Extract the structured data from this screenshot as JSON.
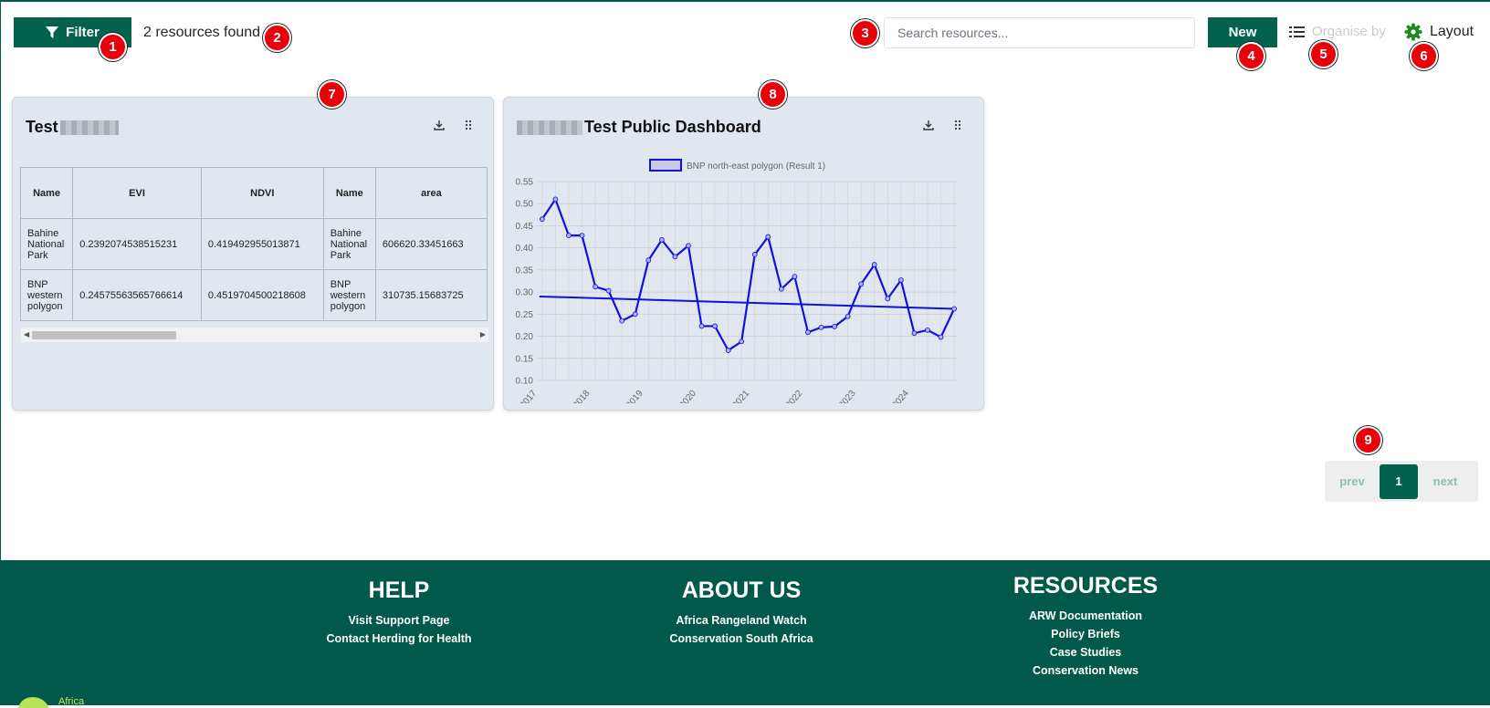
{
  "toolbar": {
    "filter_label": "Filter",
    "count_text": "2 resources found",
    "search_placeholder": "Search resources...",
    "new_label": "New",
    "organise_label": "Organise by",
    "layout_label": "Layout"
  },
  "badges": [
    "1",
    "2",
    "3",
    "4",
    "5",
    "6",
    "7",
    "8",
    "9"
  ],
  "cards": [
    {
      "title": "Test",
      "table": {
        "headers": [
          "Name",
          "EVI",
          "NDVI",
          "Name",
          "area"
        ],
        "rows": [
          [
            "Bahine National Park",
            "0.2392074538515231",
            "0.419492955013871",
            "Bahine National Park",
            "606620.33451663"
          ],
          [
            "BNP western polygon",
            "0.24575563565766614",
            "0.4519704500218608",
            "BNP western polygon",
            "310735.15683725"
          ]
        ]
      }
    },
    {
      "title": "Test Public Dashboard"
    }
  ],
  "chart_data": {
    "type": "line",
    "legend": "BNP north-east polygon (Result 1)",
    "ylim": [
      0.1,
      0.55
    ],
    "yticks": [
      "0.55",
      "0.50",
      "0.45",
      "0.40",
      "0.35",
      "0.30",
      "0.25",
      "0.20",
      "0.15",
      "0.10"
    ],
    "xticks": [
      "2017",
      "2018",
      "2019",
      "2020",
      "2021",
      "2022",
      "2023",
      "2024"
    ],
    "x_years": [
      2017.1,
      2017.35,
      2017.6,
      2017.85,
      2018.1,
      2018.35,
      2018.6,
      2018.85,
      2019.1,
      2019.35,
      2019.6,
      2019.85,
      2020.1,
      2020.35,
      2020.6,
      2020.85,
      2021.1,
      2021.35,
      2021.6,
      2021.85,
      2022.1,
      2022.35,
      2022.6,
      2022.85,
      2023.1,
      2023.35,
      2023.6,
      2023.85,
      2024.1,
      2024.35,
      2024.6,
      2024.85
    ],
    "values": [
      0.465,
      0.51,
      0.428,
      0.428,
      0.312,
      0.303,
      0.235,
      0.25,
      0.372,
      0.418,
      0.38,
      0.405,
      0.223,
      0.223,
      0.168,
      0.188,
      0.385,
      0.425,
      0.307,
      0.335,
      0.209,
      0.22,
      0.222,
      0.245,
      0.318,
      0.362,
      0.285,
      0.327,
      0.207,
      0.214,
      0.198,
      0.262
    ],
    "trend": [
      0.29,
      0.262
    ],
    "color": "#1010e0"
  },
  "pagination": {
    "prev_label": "prev",
    "current": "1",
    "next_label": "next"
  },
  "footer": {
    "help_title": "HELP",
    "help_links": [
      "Visit Support Page",
      "Contact Herding for Health"
    ],
    "about_title": "ABOUT US",
    "about_links": [
      "Africa Rangeland Watch",
      "Conservation South Africa"
    ],
    "resources_title": "RESOURCES",
    "resources_links": [
      "ARW Documentation",
      "Policy Briefs",
      "Case Studies",
      "Conservation News"
    ],
    "logo_text": "Africa"
  },
  "colors": {
    "primary": "#03624c",
    "footer_bg": "#00594a",
    "badge": "#e8000b",
    "card_bg": "#e1e7ef"
  }
}
